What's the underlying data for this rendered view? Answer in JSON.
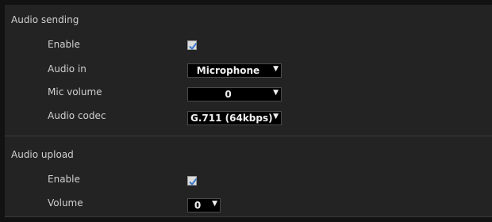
{
  "audio_sending": {
    "title": "Audio sending",
    "enable_label": "Enable",
    "enable_checked": true,
    "audio_in_label": "Audio in",
    "audio_in_value": "Microphone",
    "mic_volume_label": "Mic volume",
    "mic_volume_value": "0",
    "audio_codec_label": "Audio codec",
    "audio_codec_value": "G.711 (64kbps)"
  },
  "audio_upload": {
    "title": "Audio upload",
    "enable_label": "Enable",
    "enable_checked": true,
    "volume_label": "Volume",
    "volume_value": "0"
  },
  "colors": {
    "page_bg": "#121212",
    "panel_bg": "#232323",
    "select_bg": "#000000",
    "checkmark": "#3a78c8"
  }
}
